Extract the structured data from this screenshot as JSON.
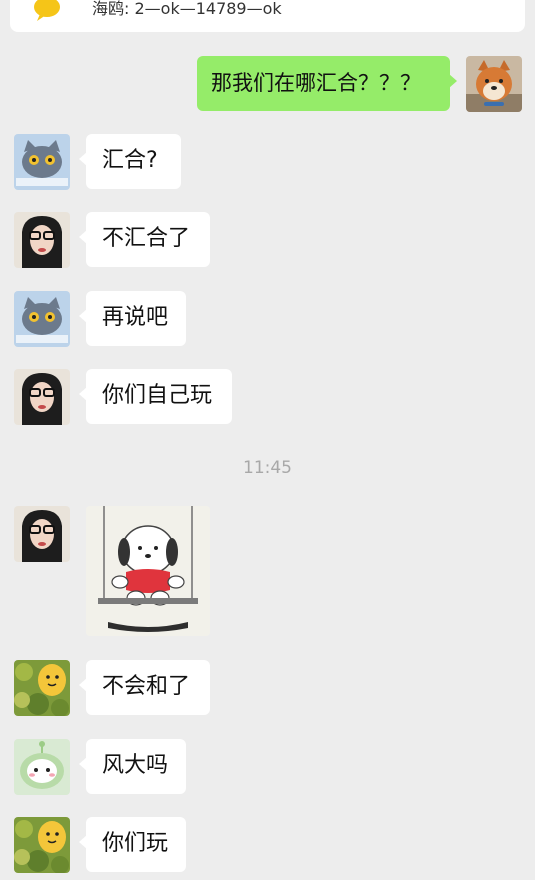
{
  "header": {
    "notice_text": "海鸥: 2—ok—14789—ok"
  },
  "timestamp": "11:45",
  "messages": [
    {
      "side": "right",
      "text": "那我们在哪汇合？？？",
      "avatar": "shiba-dog-avatar"
    },
    {
      "side": "left",
      "text": "汇合?",
      "avatar": "gray-cat-avatar"
    },
    {
      "side": "left",
      "text": "不汇合了",
      "avatar": "girl-glasses-avatar"
    },
    {
      "side": "left",
      "text": "再说吧",
      "avatar": "gray-cat-avatar"
    },
    {
      "side": "left",
      "text": "你们自己玩",
      "avatar": "girl-glasses-avatar"
    },
    {
      "side": "left",
      "text": "",
      "avatar": "girl-glasses-avatar",
      "sticker": "pochacco-swing-sticker"
    },
    {
      "side": "left",
      "text": "不会和了",
      "avatar": "yellow-face-leaves-avatar"
    },
    {
      "side": "left",
      "text": "风大吗",
      "avatar": "green-cute-avatar"
    },
    {
      "side": "left",
      "text": "你们玩",
      "avatar": "yellow-face-leaves-avatar"
    }
  ],
  "colors": {
    "background": "#ededed",
    "bubble_self": "#95ec69",
    "bubble_other": "#ffffff",
    "timestamp": "#a8a8a8"
  }
}
